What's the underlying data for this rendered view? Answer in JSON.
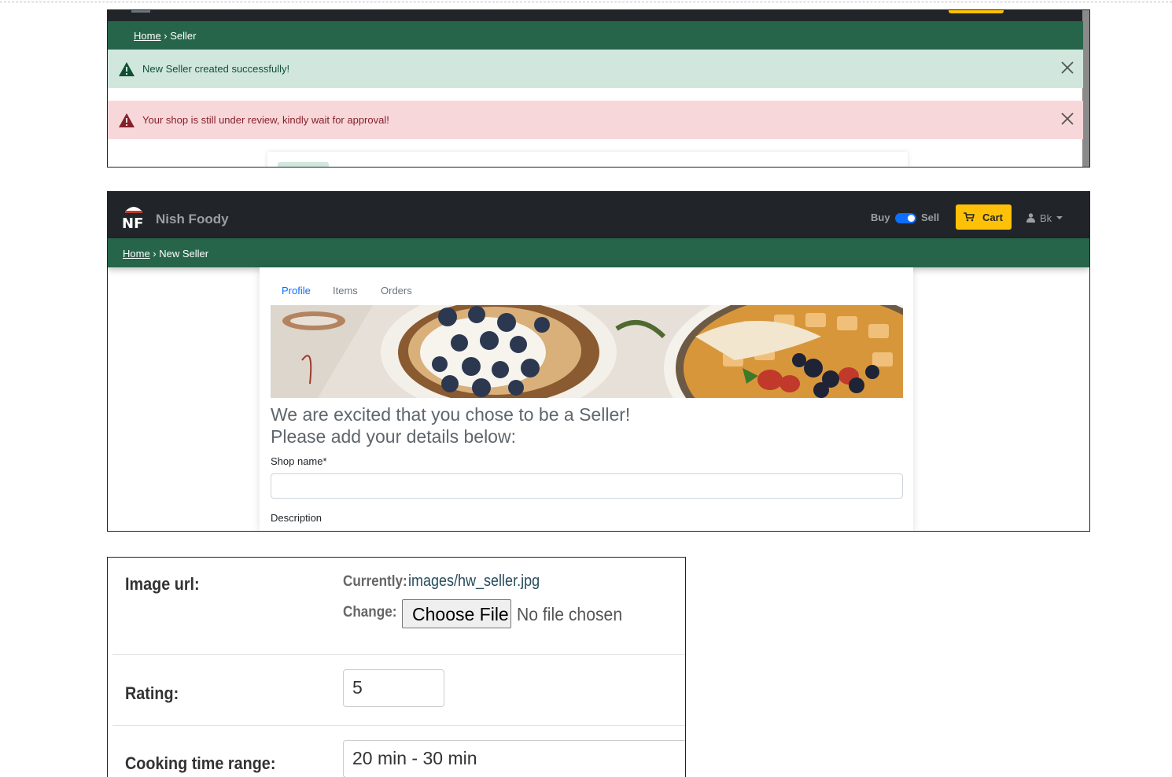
{
  "panel1": {
    "breadcrumb": {
      "home": "Home",
      "separator": " › ",
      "current": "Seller"
    },
    "alerts": [
      {
        "type": "success",
        "message": "New Seller created successfully!",
        "icon": "warning-triangle-icon",
        "color": "#0f5132"
      },
      {
        "type": "danger",
        "message": "Your shop is still under review, kindly wait for approval!",
        "icon": "warning-triangle-icon",
        "color": "#842029"
      }
    ]
  },
  "panel2": {
    "brand": {
      "name": "Nish Foody",
      "logo_text": "NF"
    },
    "toggle": {
      "left": "Buy",
      "right": "Sell",
      "state": "Sell"
    },
    "cart_label": "Cart",
    "user": "Bk",
    "breadcrumb": {
      "home": "Home",
      "separator": " › ",
      "current": "New Seller"
    },
    "tabs": [
      {
        "label": "Profile",
        "active": true
      },
      {
        "label": "Items",
        "active": false
      },
      {
        "label": "Orders",
        "active": false
      }
    ],
    "heading_line1": "We are excited that you chose to be a Seller!",
    "heading_line2": "Please add your details below:",
    "shop_name_label": "Shop name*",
    "shop_name_value": "",
    "description_label": "Description"
  },
  "panel3": {
    "image_url": {
      "label": "Image url:",
      "currently_label": "Currently:",
      "currently_value": "images/hw_seller.jpg",
      "change_label": "Change:",
      "button": "Choose File",
      "no_file": "No file chosen"
    },
    "rating": {
      "label": "Rating:",
      "value": "5"
    },
    "cooking_time": {
      "label": "Cooking time range:",
      "value": "20 min - 30 min"
    }
  },
  "colors": {
    "navbar": "#212529",
    "breadcrumb_bar": "#27654a",
    "success_bg": "#d1e7dd",
    "danger_bg": "#f8d7da",
    "cart_button": "#ffc107",
    "toggle_on": "#0d6efd",
    "link": "#0d6efd"
  }
}
